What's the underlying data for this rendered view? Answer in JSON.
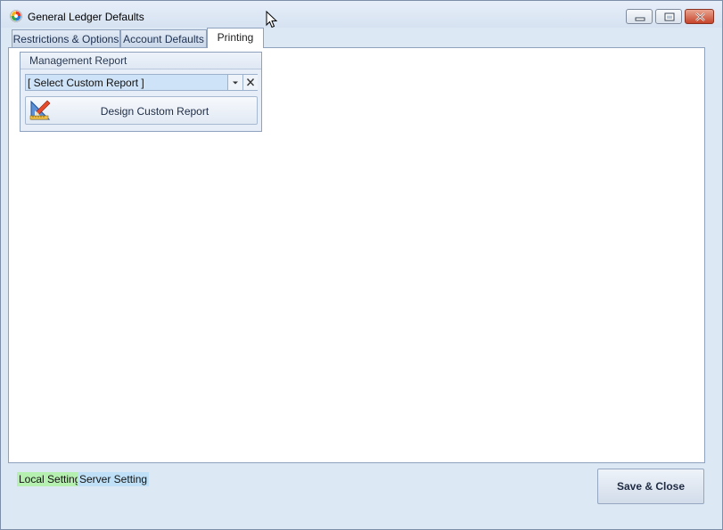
{
  "window": {
    "title": "General Ledger Defaults",
    "icon": "app-logo-icon",
    "controls": [
      "minimize-icon",
      "maximize-icon",
      "close-icon"
    ]
  },
  "tabs": [
    {
      "label": "Restrictions & Options",
      "active": false
    },
    {
      "label": "Account Defaults",
      "active": false
    },
    {
      "label": "Printing",
      "active": true
    }
  ],
  "management_report": {
    "group_title": "Management Report",
    "select_value": "[ Select Custom Report ]",
    "design_button_label": "Design Custom Report"
  },
  "legend": {
    "local_label": "Local Setting",
    "local_color": "#b6f0b0",
    "server_label": "Server Setting",
    "server_color": "#bfe0f6"
  },
  "footer": {
    "save_close_label": "Save & Close"
  }
}
